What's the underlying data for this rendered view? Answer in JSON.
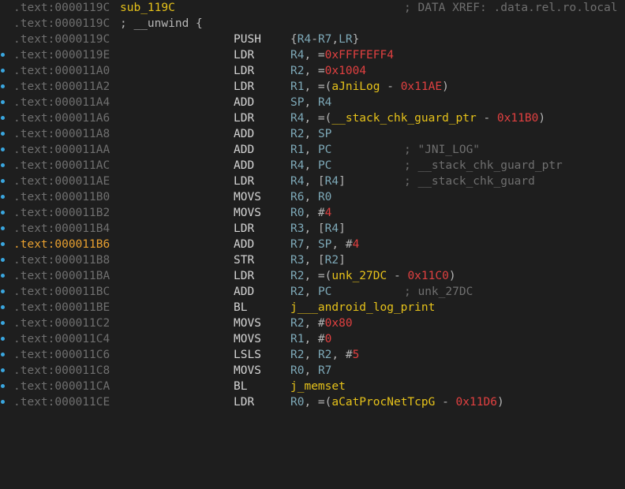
{
  "colors": {
    "background": "#1e1e1e",
    "address": "#6f6f6f",
    "address_highlight": "#e8a030",
    "label": "#e6c21a",
    "register": "#7ea9b8",
    "number": "#e04040",
    "comment": "#6f6f6f",
    "breakpoint_dot": "#3aa7e0"
  },
  "listing": {
    "lines": [
      {
        "addr": ".text:0000119C",
        "label": "sub_119C",
        "comment": "; DATA XREF: .data.rel.ro.local"
      },
      {
        "addr": ".text:0000119C",
        "label": "; __unwind {"
      },
      {
        "addr": ".text:0000119C",
        "mnemonic": "PUSH",
        "operands": "{R4-R7,LR}"
      },
      {
        "addr": ".text:0000119E",
        "mnemonic": "LDR",
        "operands": "R4, =0xFFFFEFF4"
      },
      {
        "addr": ".text:000011A0",
        "mnemonic": "LDR",
        "operands": "R2, =0x1004"
      },
      {
        "addr": ".text:000011A2",
        "mnemonic": "LDR",
        "operands": "R1, =(aJniLog - 0x11AE)"
      },
      {
        "addr": ".text:000011A4",
        "mnemonic": "ADD",
        "operands": "SP, R4"
      },
      {
        "addr": ".text:000011A6",
        "mnemonic": "LDR",
        "operands": "R4, =(__stack_chk_guard_ptr - 0x11B0)"
      },
      {
        "addr": ".text:000011A8",
        "mnemonic": "ADD",
        "operands": "R2, SP"
      },
      {
        "addr": ".text:000011AA",
        "mnemonic": "ADD",
        "operands": "R1, PC",
        "comment": "; \"JNI_LOG\""
      },
      {
        "addr": ".text:000011AC",
        "mnemonic": "ADD",
        "operands": "R4, PC",
        "comment": "; __stack_chk_guard_ptr"
      },
      {
        "addr": ".text:000011AE",
        "mnemonic": "LDR",
        "operands": "R4, [R4]",
        "comment": "; __stack_chk_guard"
      },
      {
        "addr": ".text:000011B0",
        "mnemonic": "MOVS",
        "operands": "R6, R0"
      },
      {
        "addr": ".text:000011B2",
        "mnemonic": "MOVS",
        "operands": "R0, #4"
      },
      {
        "addr": ".text:000011B4",
        "mnemonic": "LDR",
        "operands": "R3, [R4]"
      },
      {
        "addr": ".text:000011B6",
        "mnemonic": "ADD",
        "operands": "R7, SP, #4"
      },
      {
        "addr": ".text:000011B8",
        "mnemonic": "STR",
        "operands": "R3, [R2]"
      },
      {
        "addr": ".text:000011BA",
        "mnemonic": "LDR",
        "operands": "R2, =(unk_27DC - 0x11C0)"
      },
      {
        "addr": ".text:000011BC",
        "mnemonic": "ADD",
        "operands": "R2, PC",
        "comment": "; unk_27DC"
      },
      {
        "addr": ".text:000011BE",
        "mnemonic": "BL",
        "operands": "j___android_log_print"
      },
      {
        "addr": ".text:000011C2",
        "mnemonic": "MOVS",
        "operands": "R2, #0x80"
      },
      {
        "addr": ".text:000011C4",
        "mnemonic": "MOVS",
        "operands": "R1, #0"
      },
      {
        "addr": ".text:000011C6",
        "mnemonic": "LSLS",
        "operands": "R2, R2, #5"
      },
      {
        "addr": ".text:000011C8",
        "mnemonic": "MOVS",
        "operands": "R0, R7"
      },
      {
        "addr": ".text:000011CA",
        "mnemonic": "BL",
        "operands": "j_memset"
      },
      {
        "addr": ".text:000011CE",
        "mnemonic": "LDR",
        "operands": "R0, =(aCatProcNetTcpG - 0x11D6)"
      }
    ]
  }
}
